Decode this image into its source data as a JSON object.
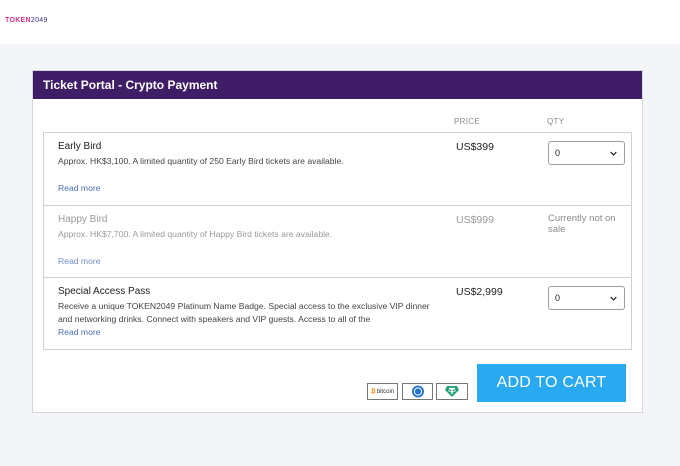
{
  "header": {
    "logo_prefix": "TOKEN",
    "logo_suffix": "2049"
  },
  "panel": {
    "title": "Ticket Portal - Crypto Payment",
    "col_price": "PRICE",
    "col_qty": "QTY"
  },
  "tickets": [
    {
      "name": "Early Bird",
      "desc": "Approx. HK$3,100. A limited quantity of 250 Early Bird tickets are available.",
      "more": "Read more",
      "price": "US$399",
      "qty": "0",
      "available": true
    },
    {
      "name": "Happy Bird",
      "desc": "Approx. HK$7,700. A limited quantity of Happy Bird tickets are available.",
      "more": "Read more",
      "price": "US$999",
      "status": "Currently not on sale",
      "available": false
    },
    {
      "name": "Special Access Pass",
      "desc": "Receive a unique TOKEN2049 Platinum Name Badge. Special access to the exclusive VIP dinner and networking drinks. Connect with speakers and VIP guests. Access to all of the",
      "more": "Read more",
      "price": "US$2,999",
      "qty": "0",
      "available": true
    }
  ],
  "payment": {
    "bitcoin_label": "bitcoin",
    "icons": [
      "bitcoin-icon",
      "usdc-icon",
      "tether-icon"
    ]
  },
  "cart": {
    "button_label": "ADD TO CART",
    "color": "#29a9ef"
  },
  "colors": {
    "header_bg": "#3f1d67",
    "link": "#4a6fb5"
  }
}
